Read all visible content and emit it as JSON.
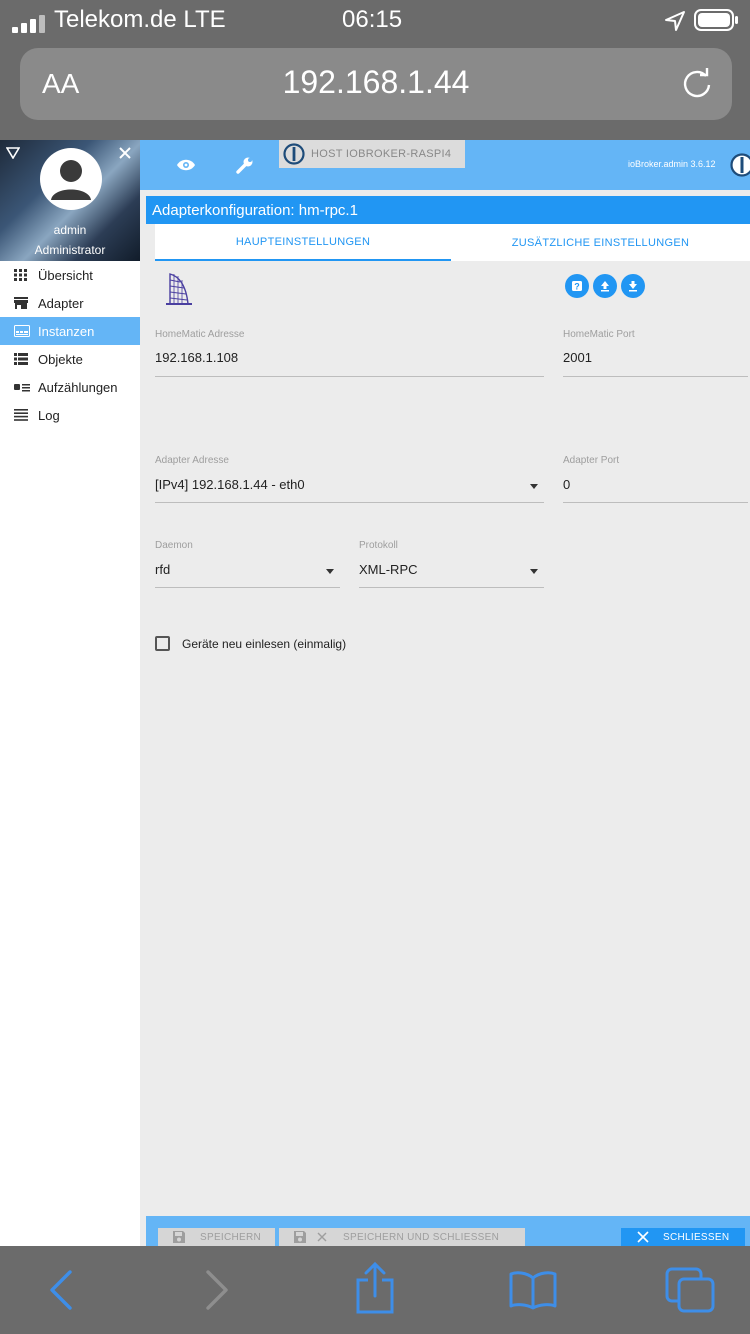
{
  "status_bar": {
    "carrier": "Telekom.de LTE",
    "time": "06:15"
  },
  "browser": {
    "text_size_label": "AA",
    "url": "192.168.1.44"
  },
  "sidebar": {
    "username": "admin",
    "role": "Administrator",
    "items": [
      {
        "label": "Übersicht",
        "icon": "grid-icon",
        "active": false
      },
      {
        "label": "Adapter",
        "icon": "store-icon",
        "active": false
      },
      {
        "label": "Instanzen",
        "icon": "instances-icon",
        "active": true
      },
      {
        "label": "Objekte",
        "icon": "list-icon",
        "active": false
      },
      {
        "label": "Aufzählungen",
        "icon": "enum-icon",
        "active": false
      },
      {
        "label": "Log",
        "icon": "log-icon",
        "active": false
      }
    ]
  },
  "header": {
    "host_label": "HOST IOBROKER-RASPI4",
    "version": "ioBroker.admin 3.6.12"
  },
  "config": {
    "title": "Adapterkonfiguration: hm-rpc.1",
    "tabs": [
      "HAUPTEINSTELLUNGEN",
      "ZUSÄTZLICHE EINSTELLUNGEN"
    ],
    "homematic_address_label": "HomeMatic Adresse",
    "homematic_address": "192.168.1.108",
    "homematic_port_label": "HomeMatic Port",
    "homematic_port": "2001",
    "adapter_address_label": "Adapter Adresse",
    "adapter_address": "[IPv4] 192.168.1.44 - eth0",
    "adapter_port_label": "Adapter Port",
    "adapter_port": "0",
    "daemon_label": "Daemon",
    "daemon": "rfd",
    "protocol_label": "Protokoll",
    "protocol": "XML-RPC",
    "checkbox_label": "Geräte neu einlesen (einmalig)",
    "checkbox_checked": false
  },
  "footer": {
    "save": "SPEICHERN",
    "save_close": "SPEICHERN UND SCHLIESSEN",
    "close": "SCHLIESSEN"
  },
  "colors": {
    "accent": "#2196f3",
    "header": "#64b5f6",
    "chrome": "#6b6b6b",
    "ios_blue": "#3e8ee8"
  }
}
